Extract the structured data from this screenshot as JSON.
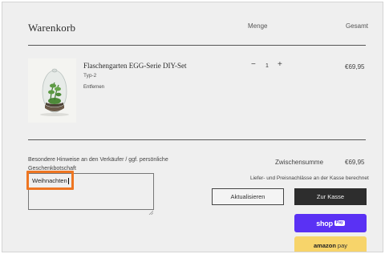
{
  "header": {
    "title": "Warenkorb",
    "col_quantity": "Menge",
    "col_total": "Gesamt"
  },
  "item": {
    "title": "Flaschengarten EGG-Serie DIY-Set",
    "variant": "Typ-2",
    "remove_label": "Entfernen",
    "quantity": "1",
    "minus_label": "−",
    "plus_label": "+",
    "price": "€69,95"
  },
  "note": {
    "label": "Besondere Hinweise an den Verkäufer / ggf. persönliche Geschenkbotschaft",
    "value": "Weihnachten"
  },
  "summary": {
    "subtotal_label": "Zwischensumme",
    "subtotal_value": "€69,95",
    "shipping_note": "Liefer- und Preisnachlässe an der Kasse berechnet"
  },
  "actions": {
    "update_label": "Aktualisieren",
    "checkout_label": "Zur Kasse",
    "shoppay_word": "shop",
    "shoppay_badge": "Pay",
    "amazon_word": "amazon",
    "amazon_pay": "pay"
  },
  "colors": {
    "highlight": "#ee7622",
    "shoppay": "#5a31f4",
    "amazonpay": "#f7d46a",
    "checkout": "#2d2d2d"
  }
}
